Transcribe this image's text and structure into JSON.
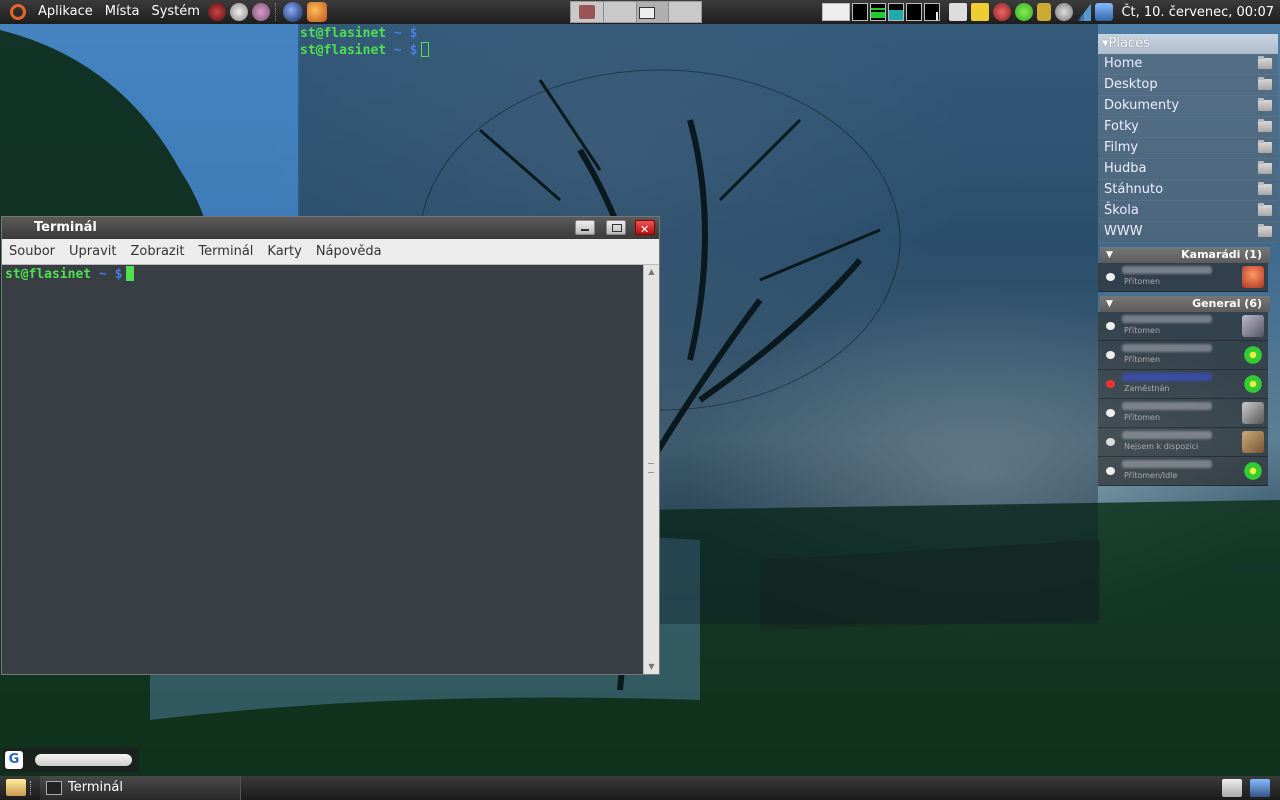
{
  "top_panel": {
    "menu": [
      "Aplikace",
      "Místa",
      "Systém"
    ],
    "clock": "Čt, 10. červenec, 00:07",
    "icons": [
      "ubuntu-logo-icon",
      "firefox-icon",
      "network-icon",
      "pidgin-icon",
      "browser-icon",
      "update-icon"
    ]
  },
  "desktop_terminal": {
    "user": "st@flasinet",
    "tilde": "~",
    "prompt_char": "$"
  },
  "places": {
    "header": "Places",
    "items": [
      "Home",
      "Desktop",
      "Dokumenty",
      "Fotky",
      "Filmy",
      "Hudba",
      "Stáhnuto",
      "Škola",
      "WWW"
    ]
  },
  "buddy_list": {
    "groups": [
      {
        "name": "Kamarádi (1)",
        "contacts": [
          {
            "status": "Přítomen"
          }
        ]
      },
      {
        "name": "General (6)",
        "contacts": [
          {
            "status": "Přítomen"
          },
          {
            "status": "Přítomen"
          },
          {
            "status": "Zaměstnán"
          },
          {
            "status": "Přítomen"
          },
          {
            "status": "Nejsem k dispozici"
          },
          {
            "status": "Přítomen/Idle"
          }
        ]
      }
    ]
  },
  "terminal_window": {
    "title": "Terminál",
    "menu": [
      "Soubor",
      "Upravit",
      "Zobrazit",
      "Terminál",
      "Karty",
      "Nápověda"
    ],
    "prompt_user": "st@flasinet",
    "prompt_tilde": "~",
    "prompt_char": "$"
  },
  "bottom_panel": {
    "task_label": "Terminál"
  },
  "colors": {
    "prompt_green": "#4ee04e",
    "prompt_blue": "#4a7fe0",
    "close_red": "#d22"
  }
}
